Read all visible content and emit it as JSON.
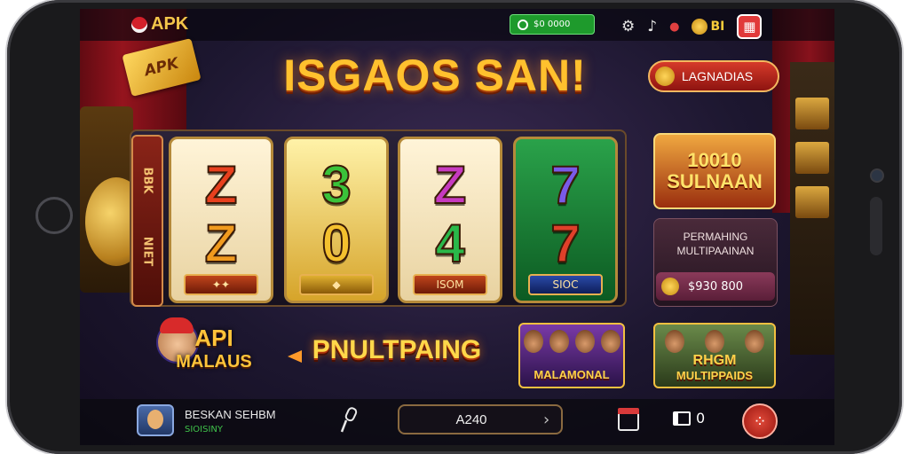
{
  "app": {
    "brand": "APK"
  },
  "topbar": {
    "balance": "$0 0000",
    "icon_names": [
      "gear-icon",
      "sound-icon",
      "location-icon"
    ],
    "coins_label": "BI",
    "menu_icon": "grid-icon"
  },
  "banner": {
    "ribbon": "APK",
    "title": "ISGAOS SAN!"
  },
  "leaderboard_button": {
    "label": "LAGNADIAS"
  },
  "slot": {
    "side_label_top": "BBK",
    "side_label_bottom": "NIET",
    "reels": [
      {
        "symbols": [
          "Z",
          "Z"
        ],
        "plate": "",
        "colors": [
          "#e8401e",
          "#f09a1e"
        ],
        "bg": "ivory"
      },
      {
        "symbols": [
          "3",
          "0"
        ],
        "plate": "",
        "colors": [
          "#3ac23a",
          "#f4c02e"
        ],
        "bg": "gold"
      },
      {
        "symbols": [
          "Z",
          "4"
        ],
        "plate": "ISOM",
        "colors": [
          "#c63ac0",
          "#2ab84a"
        ],
        "bg": "ivory"
      },
      {
        "symbols": [
          "7",
          "7"
        ],
        "plate": "SIOC",
        "colors": [
          "#7a5ae8",
          "#e0402a"
        ],
        "bg": "green"
      }
    ]
  },
  "promo": {
    "line1": "10010",
    "line2": "SULNAAN"
  },
  "multiplayer_panel": {
    "title": "PERMAHING MULTIPAAINAN",
    "value": "$930 800"
  },
  "bottom_promos": {
    "character_line1": "API",
    "character_line2": "MALAUS",
    "multi_text": "PNULTPAING",
    "card1_label": "MALAMONAL",
    "card2_label_line1": "RHGM",
    "card2_label_line2": "MULTIPPAIDS"
  },
  "bottombar": {
    "player_name": "BESKAN SEHBM",
    "player_sub": "SIOISINY",
    "bet_value": "A240",
    "count": "0"
  }
}
